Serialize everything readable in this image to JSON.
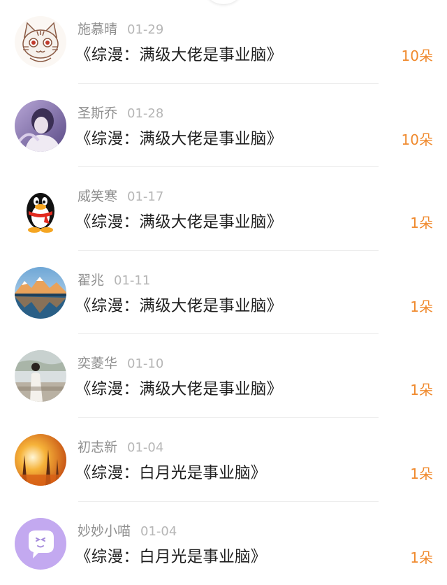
{
  "colors": {
    "name": "#8f8f8f",
    "date": "#b6b6b6",
    "title": "#1f1f1f",
    "amount": "#f08a2e",
    "divider": "#ededed"
  },
  "items": [
    {
      "name": "施慕晴",
      "date": "01-29",
      "title": "《综漫：满级大佬是事业脑》",
      "amount": "10朵",
      "avatar": "cat-avatar"
    },
    {
      "name": "圣斯乔",
      "date": "01-28",
      "title": "《综漫：满级大佬是事业脑》",
      "amount": "10朵",
      "avatar": "photo-avatar"
    },
    {
      "name": "威笑寒",
      "date": "01-17",
      "title": "《综漫：满级大佬是事业脑》",
      "amount": "1朵",
      "avatar": "penguin-avatar"
    },
    {
      "name": "翟兆",
      "date": "01-11",
      "title": "《综漫：满级大佬是事业脑》",
      "amount": "1朵",
      "avatar": "landscape-avatar"
    },
    {
      "name": "奕菱华",
      "date": "01-10",
      "title": "《综漫：满级大佬是事业脑》",
      "amount": "1朵",
      "avatar": "person-photo-avatar"
    },
    {
      "name": "初志新",
      "date": "01-04",
      "title": "《综漫：白月光是事业脑》",
      "amount": "1朵",
      "avatar": "autumn-avatar"
    },
    {
      "name": "妙妙小喵",
      "date": "01-04",
      "title": "《综漫：白月光是事业脑》",
      "amount": "1朵",
      "avatar": "chat-bubble-avatar"
    }
  ]
}
